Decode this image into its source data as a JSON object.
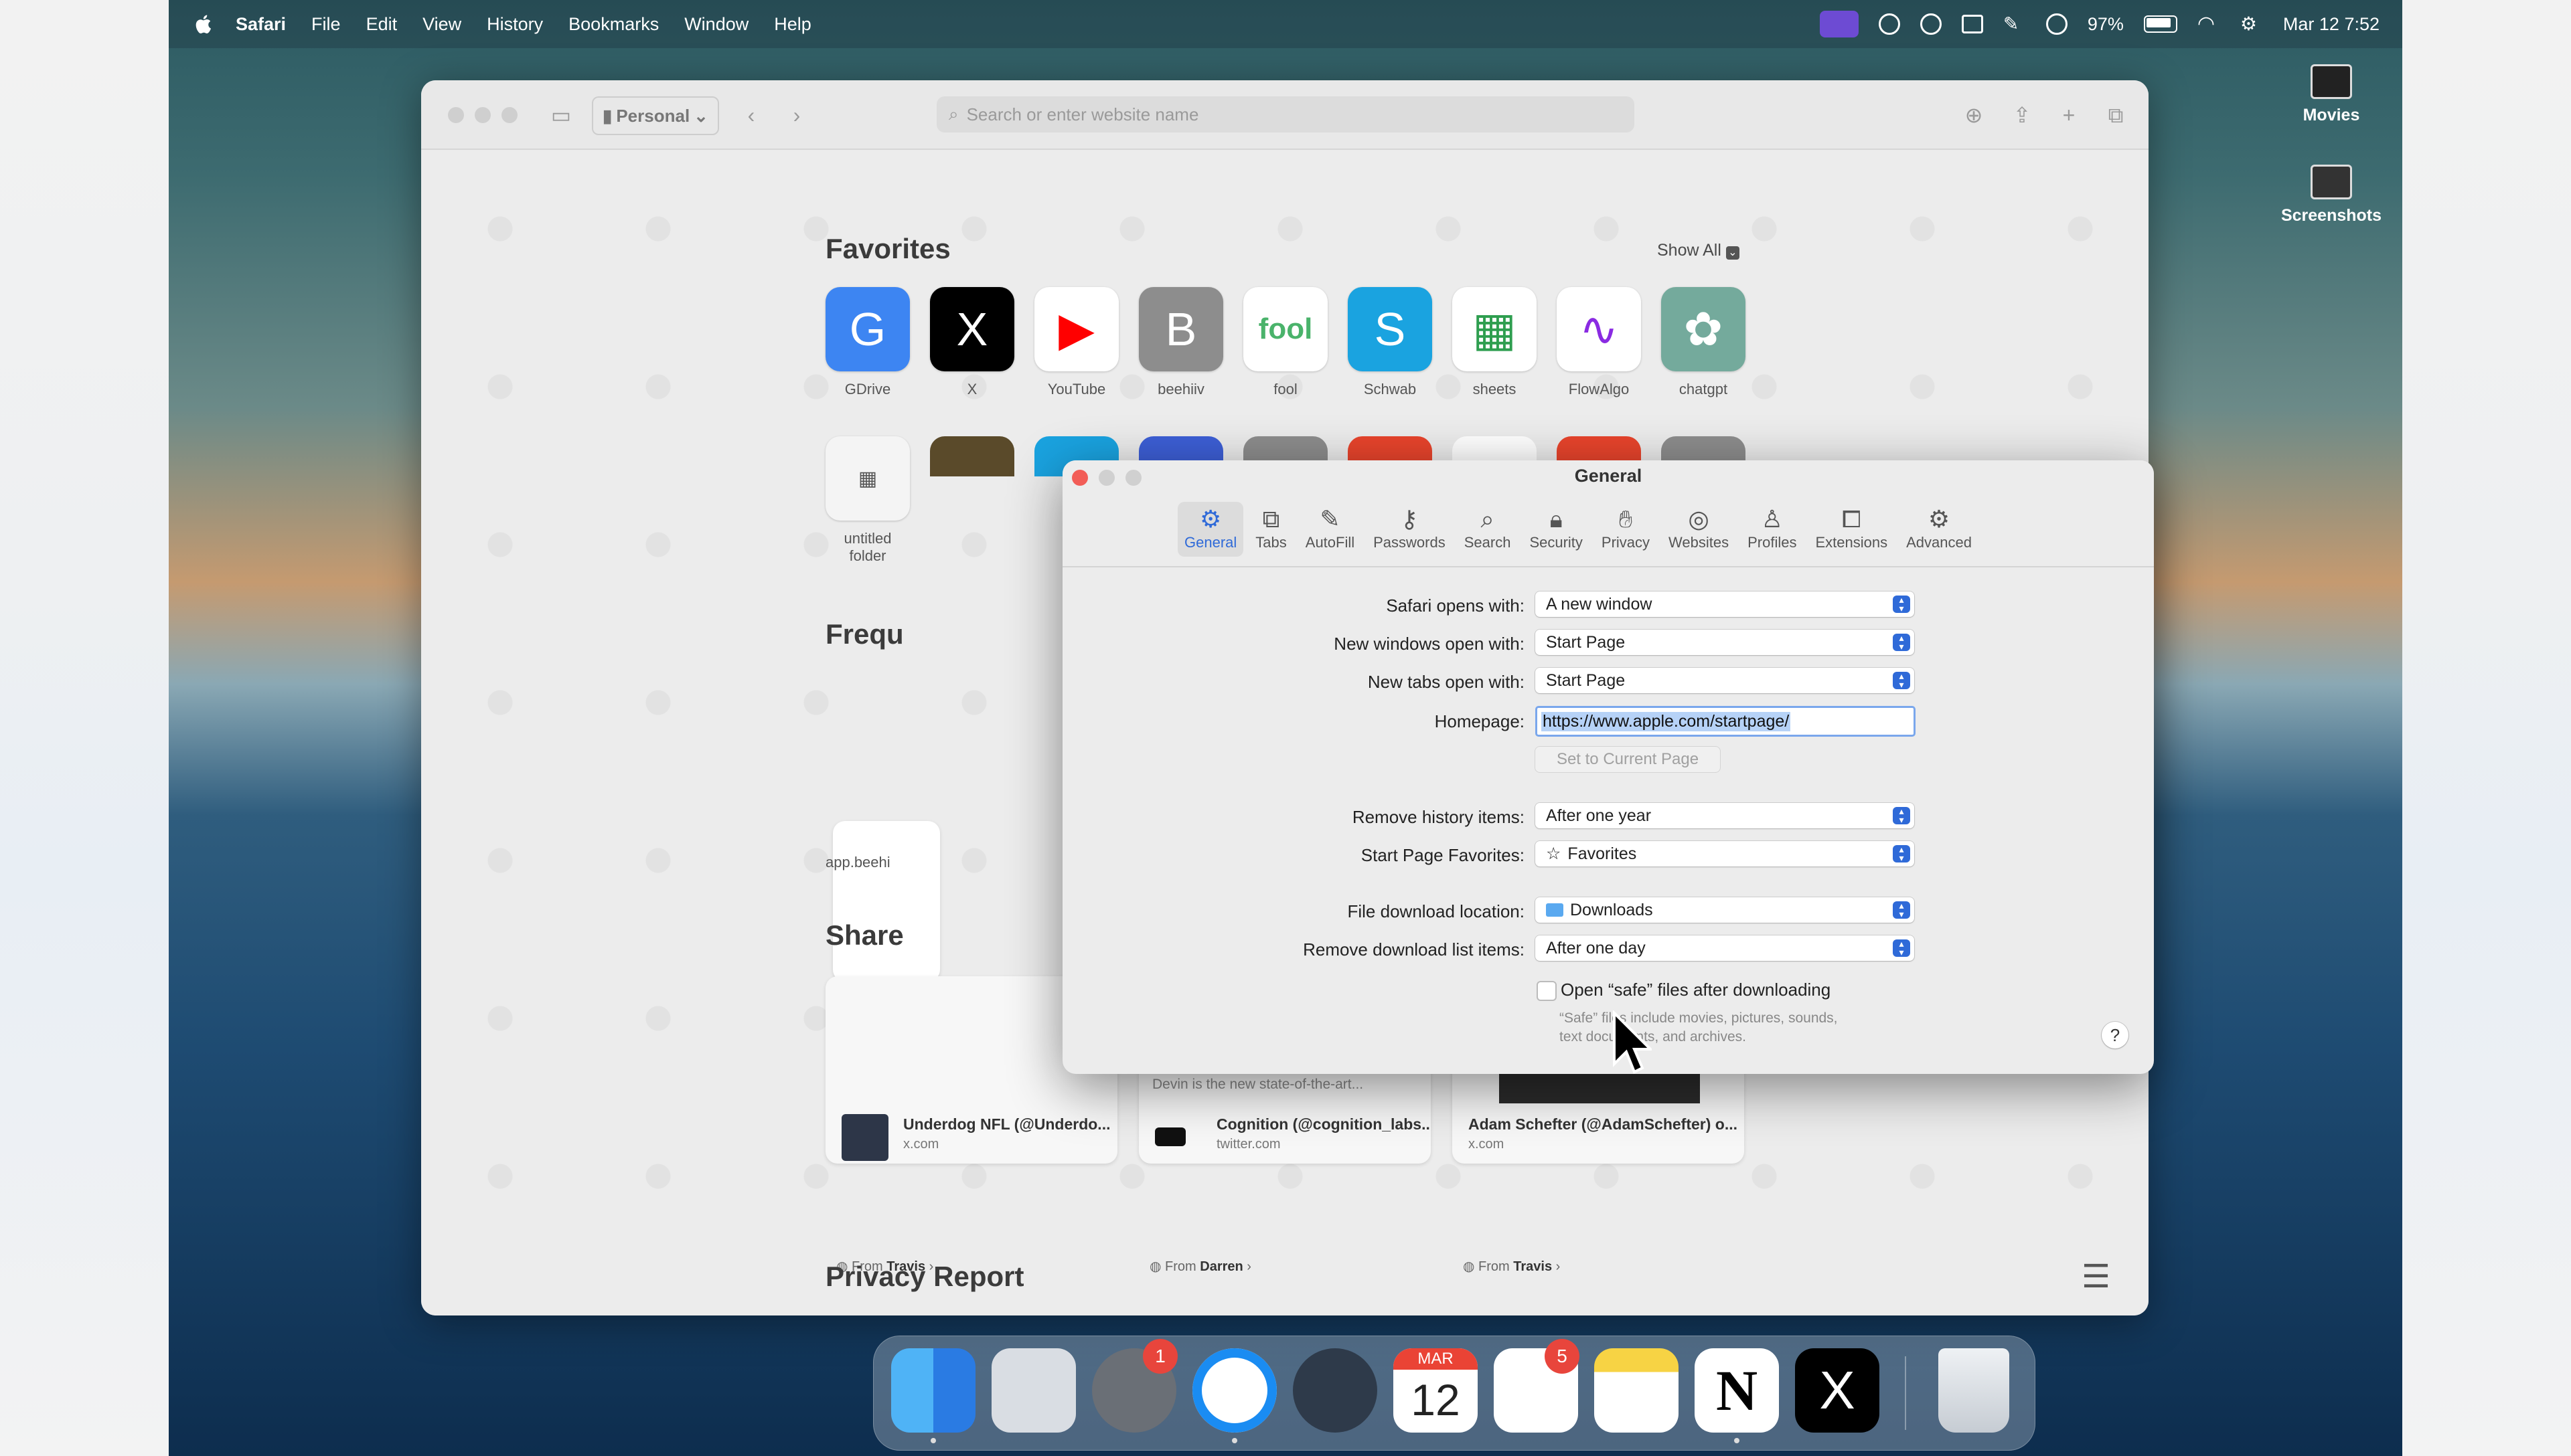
{
  "menubar": {
    "app_name": "Safari",
    "menus": [
      "File",
      "Edit",
      "View",
      "History",
      "Bookmarks",
      "Window",
      "Help"
    ],
    "battery": "97%",
    "clock": "Mar 12  7:52"
  },
  "desktop_icons": [
    {
      "label": "Movies"
    },
    {
      "label": "Screenshots"
    }
  ],
  "safari": {
    "profile": "Personal",
    "url_placeholder": "Search or enter website name",
    "favorites_title": "Favorites",
    "show_all": "Show All",
    "favorites": [
      {
        "label": "GDrive",
        "glyph": "G",
        "color": "#3d85f2"
      },
      {
        "label": "X",
        "glyph": "X",
        "color": "#000000"
      },
      {
        "label": "YouTube",
        "glyph": "▶",
        "color": "#ffffff"
      },
      {
        "label": "beehiiv",
        "glyph": "B",
        "color": "#8d8d8d"
      },
      {
        "label": "fool",
        "glyph": "fool",
        "color": "#ffffff"
      },
      {
        "label": "Schwab",
        "glyph": "S",
        "color": "#1aa3e0"
      },
      {
        "label": "sheets",
        "glyph": "▦",
        "color": "#ffffff"
      },
      {
        "label": "FlowAlgo",
        "glyph": "∿",
        "color": "#ffffff"
      },
      {
        "label": "chatgpt",
        "glyph": "✿",
        "color": "#74aa9c"
      }
    ],
    "folder_label_line1": "untitled",
    "folder_label_line2": "folder",
    "frequently_title": "Frequ",
    "frequent_label": "app.beehi",
    "shared_title": "Share",
    "shared": [
      {
        "title": "Underdog NFL (@Underdo...",
        "site": "x.com",
        "from_prefix": "From",
        "from_name": "Travis"
      },
      {
        "title": "Cognition (@cognition_labs...",
        "site": "twitter.com",
        "from_prefix": "From",
        "from_name": "Darren",
        "caption": "Devin is the new state-of-the-art..."
      },
      {
        "title": "Adam Schefter (@AdamSchefter) o...",
        "site": "x.com",
        "from_prefix": "From",
        "from_name": "Travis"
      }
    ],
    "privacy_title": "Privacy Report"
  },
  "prefs": {
    "title": "General",
    "tabs": [
      "General",
      "Tabs",
      "AutoFill",
      "Passwords",
      "Search",
      "Security",
      "Privacy",
      "Websites",
      "Profiles",
      "Extensions",
      "Advanced"
    ],
    "safari_opens_with_label": "Safari opens with:",
    "safari_opens_with_value": "A new window",
    "new_windows_label": "New windows open with:",
    "new_windows_value": "Start Page",
    "new_tabs_label": "New tabs open with:",
    "new_tabs_value": "Start Page",
    "homepage_label": "Homepage:",
    "homepage_value": "https://www.apple.com/startpage/",
    "set_current_label": "Set to Current Page",
    "remove_history_label": "Remove history items:",
    "remove_history_value": "After one year",
    "start_page_fav_label": "Start Page Favorites:",
    "start_page_fav_value": "Favorites",
    "download_loc_label": "File download location:",
    "download_loc_value": "Downloads",
    "remove_download_label": "Remove download list items:",
    "remove_download_value": "After one day",
    "open_safe_label": "Open “safe” files after downloading",
    "safe_hint_1": "“Safe” files include movies, pictures, sounds,",
    "safe_hint_2": "text documents, and archives.",
    "help": "?"
  },
  "dock": {
    "calendar_month": "MAR",
    "calendar_day": "12",
    "settings_badge": "1",
    "reminders_badge": "5"
  }
}
